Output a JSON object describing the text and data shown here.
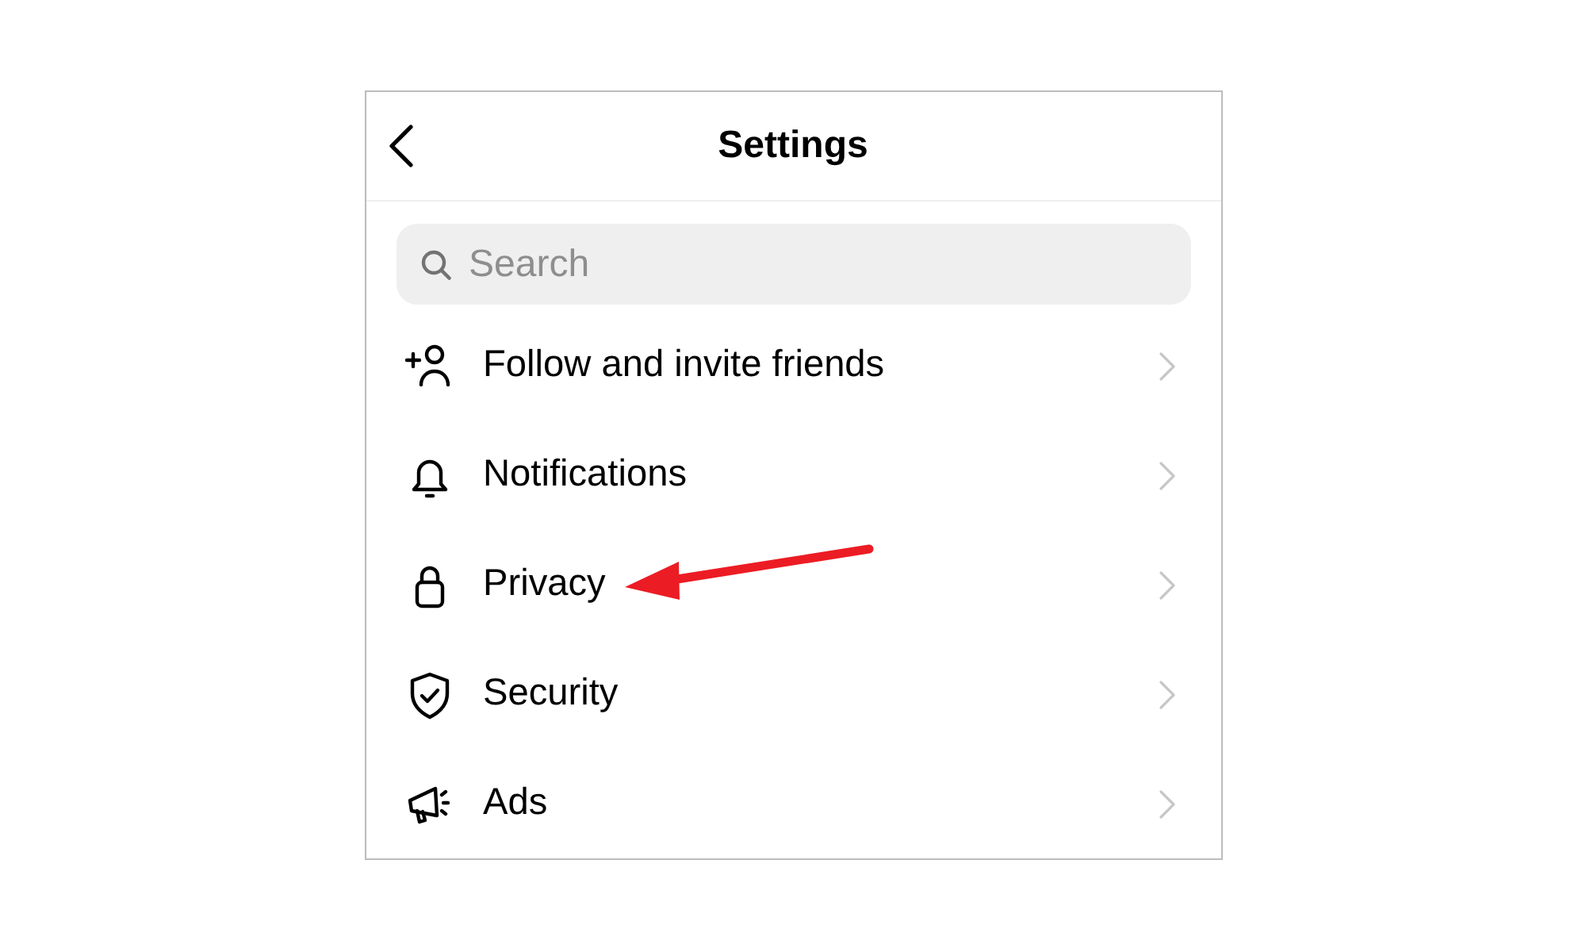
{
  "header": {
    "title": "Settings"
  },
  "search": {
    "placeholder": "Search"
  },
  "items": [
    {
      "label": "Follow and invite friends",
      "marked": false
    },
    {
      "label": "Notifications",
      "marked": false
    },
    {
      "label": "Privacy",
      "marked": true
    },
    {
      "label": "Security",
      "marked": false
    },
    {
      "label": "Ads",
      "marked": false
    }
  ]
}
